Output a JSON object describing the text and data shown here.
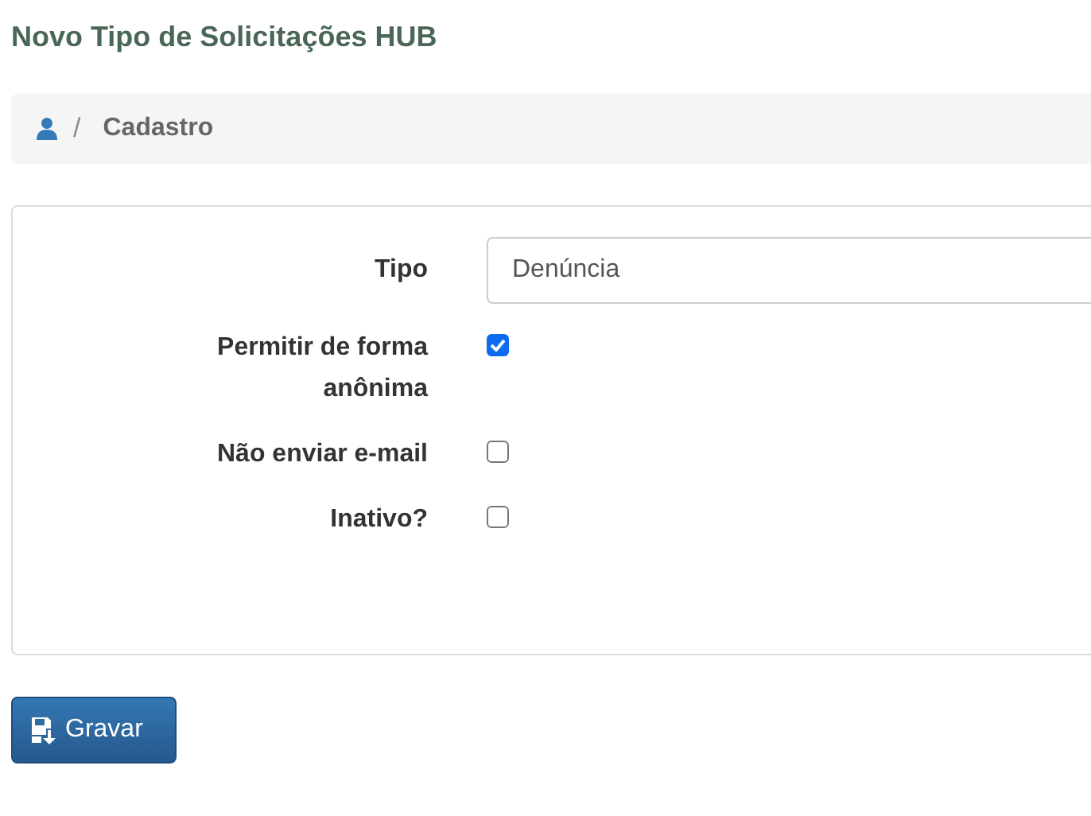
{
  "page_title": "Novo Tipo de Solicitações HUB",
  "breadcrumb": {
    "separator": "/",
    "items": [
      "Cadastro"
    ]
  },
  "form": {
    "fields": [
      {
        "kind": "text",
        "label": "Tipo",
        "value": "Denúncia"
      },
      {
        "kind": "checkbox",
        "label": "Permitir de forma anônima",
        "checked": true
      },
      {
        "kind": "checkbox",
        "label": "Não enviar e-mail",
        "checked": false
      },
      {
        "kind": "checkbox",
        "label": "Inativo?",
        "checked": false
      }
    ]
  },
  "buttons": [
    {
      "label": "Gravar"
    }
  ]
}
